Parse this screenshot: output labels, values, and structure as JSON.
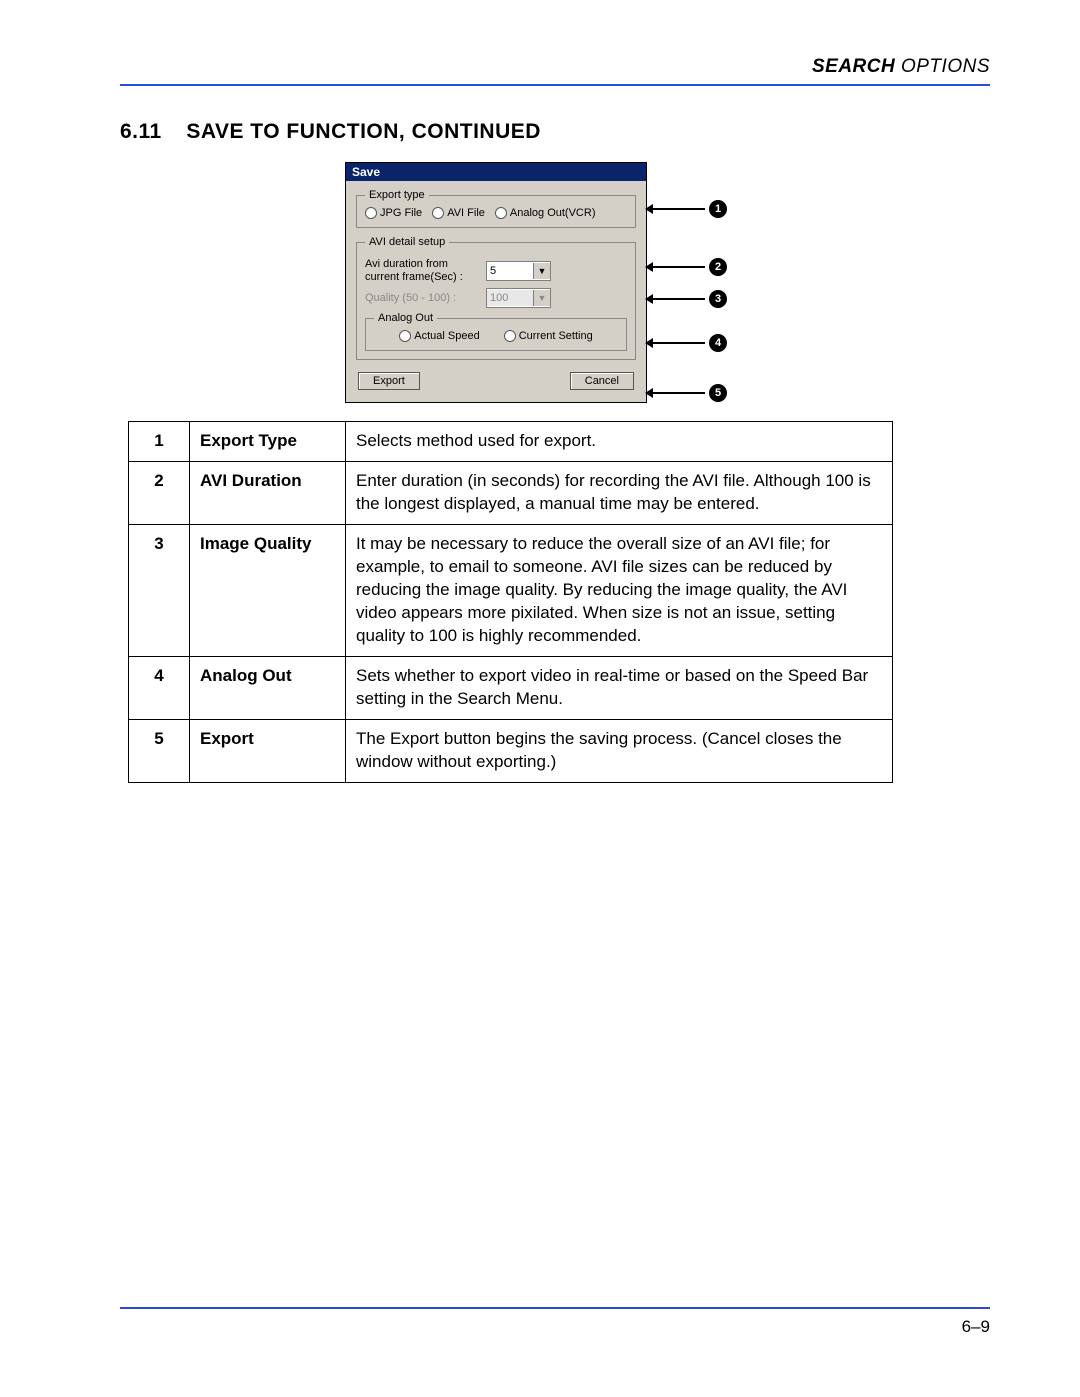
{
  "header": {
    "bold": "SEARCH",
    "light": " OPTIONS"
  },
  "section": {
    "number": "6.11",
    "title": "SAVE TO FUNCTION, CONTINUED"
  },
  "dialog": {
    "title": "Save",
    "export_type": {
      "legend": "Export type",
      "opts": [
        "JPG File",
        "AVI File",
        "Analog Out(VCR)"
      ]
    },
    "avi_detail": {
      "legend": "AVI detail setup",
      "duration_label": "Avi duration from current frame(Sec) :",
      "duration_value": "5",
      "quality_label": "Quality (50 - 100) :",
      "quality_value": "100"
    },
    "analog_out": {
      "legend": "Analog Out",
      "opts": [
        "Actual Speed",
        "Current Setting"
      ]
    },
    "buttons": {
      "export": "Export",
      "cancel": "Cancel"
    }
  },
  "callouts": [
    "1",
    "2",
    "3",
    "4",
    "5"
  ],
  "table": [
    {
      "n": "1",
      "name": "Export Type",
      "desc": "Selects method used for export."
    },
    {
      "n": "2",
      "name": "AVI Duration",
      "desc": "Enter duration (in seconds) for recording the AVI file. Although 100 is the longest displayed, a manual time may be entered."
    },
    {
      "n": "3",
      "name": "Image Quality",
      "desc": "It may be necessary to reduce the overall size of an AVI file; for example, to email to someone. AVI file sizes can be reduced by reducing the image quality. By reducing the image quality, the AVI video appears more pixilated. When size is not an issue, setting quality to 100 is highly recommended."
    },
    {
      "n": "4",
      "name": "Analog Out",
      "desc": "Sets whether to export video in real-time or based on the Speed Bar setting in the Search Menu."
    },
    {
      "n": "5",
      "name": "Export",
      "desc": "The Export button begins the saving process. (Cancel closes the window without exporting.)"
    }
  ],
  "footer": {
    "page": "6–9"
  }
}
